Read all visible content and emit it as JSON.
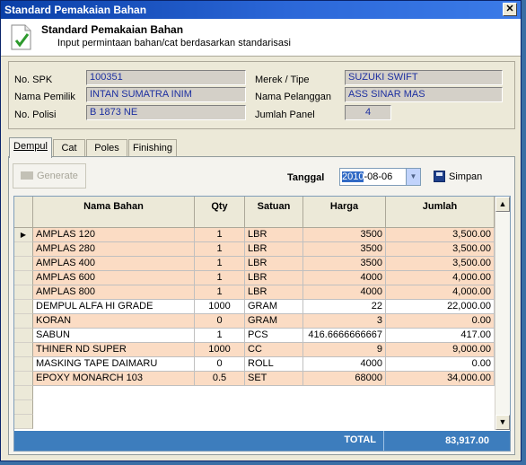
{
  "window": {
    "title": "Standard Pemakaian Bahan",
    "close_label": "✕"
  },
  "header": {
    "title": "Standard Pemakaian Bahan",
    "subtitle": "Input permintaan bahan/cat berdasarkan standarisasi"
  },
  "info": {
    "no_spk_label": "No. SPK",
    "no_spk": "100351",
    "nama_pemilik_label": "Nama Pemilik",
    "nama_pemilik": "INTAN SUMATRA INIM",
    "no_polisi_label": "No. Polisi",
    "no_polisi": "B 1873 NE",
    "merek_label": "Merek / Tipe",
    "merek": "SUZUKI SWIFT",
    "pelanggan_label": "Nama Pelanggan",
    "pelanggan": "ASS SINAR MAS",
    "jumlah_panel_label": "Jumlah Panel",
    "jumlah_panel": "4"
  },
  "tabs": [
    "Dempul",
    "Cat",
    "Poles",
    "Finishing"
  ],
  "toolbar": {
    "generate_label": "Generate",
    "tanggal_label": "Tanggal",
    "date_year": "2010",
    "date_rest": "-08-06",
    "simpan_label": "Simpan"
  },
  "grid": {
    "columns": [
      "Nama Bahan",
      "Qty",
      "Satuan",
      "Harga",
      "Jumlah"
    ],
    "rows": [
      {
        "nama": "AMPLAS 120",
        "qty": "1",
        "satuan": "LBR",
        "harga": "3500",
        "jumlah": "3,500.00"
      },
      {
        "nama": "AMPLAS 280",
        "qty": "1",
        "satuan": "LBR",
        "harga": "3500",
        "jumlah": "3,500.00"
      },
      {
        "nama": "AMPLAS 400",
        "qty": "1",
        "satuan": "LBR",
        "harga": "3500",
        "jumlah": "3,500.00"
      },
      {
        "nama": "AMPLAS 600",
        "qty": "1",
        "satuan": "LBR",
        "harga": "4000",
        "jumlah": "4,000.00"
      },
      {
        "nama": "AMPLAS 800",
        "qty": "1",
        "satuan": "LBR",
        "harga": "4000",
        "jumlah": "4,000.00"
      },
      {
        "nama": "DEMPUL ALFA HI GRADE",
        "qty": "1000",
        "satuan": "GRAM",
        "harga": "22",
        "jumlah": "22,000.00"
      },
      {
        "nama": "KORAN",
        "qty": "0",
        "satuan": "GRAM",
        "harga": "3",
        "jumlah": "0.00"
      },
      {
        "nama": "SABUN",
        "qty": "1",
        "satuan": "PCS",
        "harga": "416.6666666667",
        "jumlah": "417.00"
      },
      {
        "nama": "THINER ND SUPER",
        "qty": "1000",
        "satuan": "CC",
        "harga": "9",
        "jumlah": "9,000.00"
      },
      {
        "nama": "MASKING TAPE DAIMARU",
        "qty": "0",
        "satuan": "ROLL",
        "harga": "4000",
        "jumlah": "0.00"
      },
      {
        "nama": "EPOXY MONARCH 103",
        "qty": "0.5",
        "satuan": "SET",
        "harga": "68000",
        "jumlah": "34,000.00"
      }
    ],
    "total_label": "TOTAL",
    "total_value": "83,917.00",
    "row_colors": {
      "highlight": "#fbdcc4",
      "plain": "#ffffff"
    }
  }
}
